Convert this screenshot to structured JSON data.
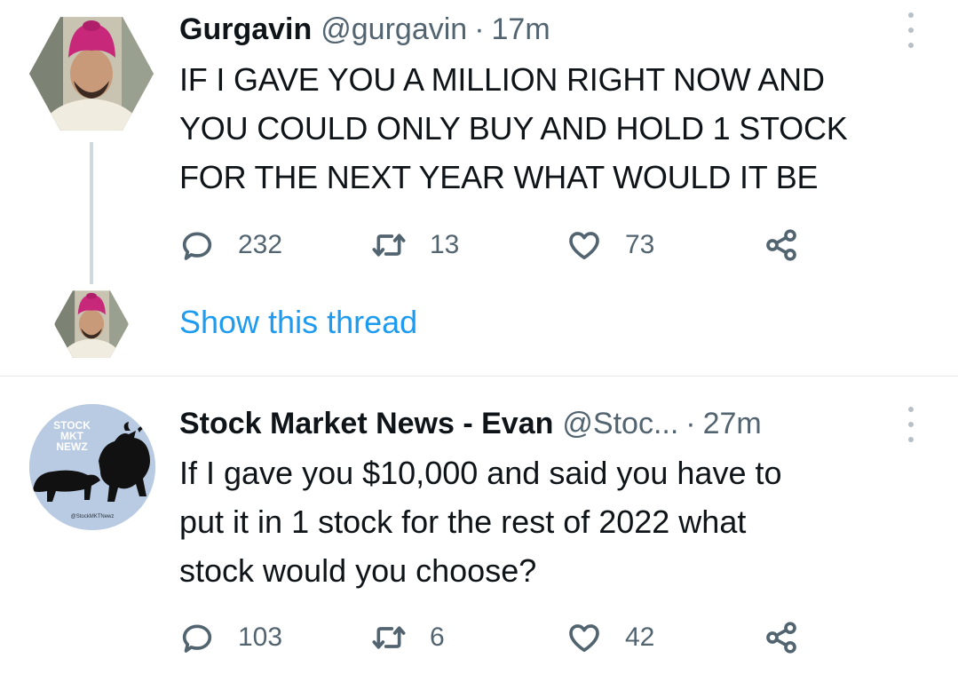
{
  "tweets": [
    {
      "author_name": "Gurgavin",
      "handle": "@gurgavin",
      "separator": "·",
      "time": "17m",
      "text": "IF I GAVE YOU A MILLION RIGHT NOW AND\nYOU COULD ONLY BUY AND HOLD 1 STOCK\nFOR THE NEXT YEAR WHAT WOULD IT BE",
      "replies": "232",
      "retweets": "13",
      "likes": "73",
      "show_thread_label": "Show this thread"
    },
    {
      "author_name": "Stock Market News - Evan",
      "handle": "@Stoc...",
      "separator": "·",
      "time": "27m",
      "text": "If I gave you $10,000 and said you have to\nput it in 1 stock for the rest of 2022 what\nstock would you choose?",
      "replies": "103",
      "retweets": "6",
      "likes": "42",
      "avatar_logo_text": [
        "STOCK",
        "MKT",
        "NEWZ"
      ],
      "avatar_logo_handle": "@StockMKTNewz"
    }
  ],
  "colors": {
    "text_primary": "#0f1419",
    "text_secondary": "#536471",
    "link_blue": "#1d9bf0",
    "divider": "#e4e8eb",
    "thread_line": "#cfd9de",
    "logo_background": "#b9cbe2"
  },
  "icons": [
    "reply-icon",
    "retweet-icon",
    "like-icon",
    "share-icon",
    "more-options-icon"
  ]
}
